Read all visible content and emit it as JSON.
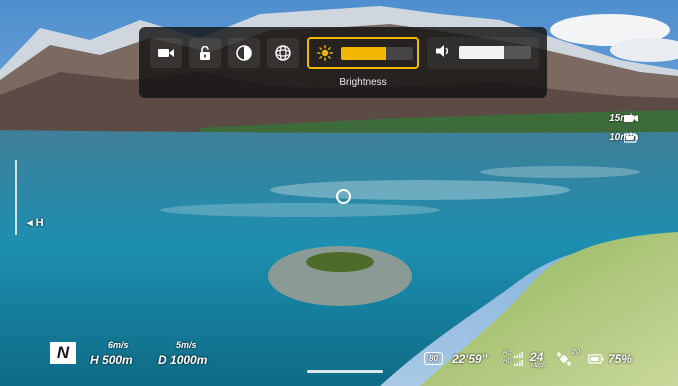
{
  "toolbar": {
    "tools": [
      {
        "name": "video-camera-icon"
      },
      {
        "name": "unlock-icon"
      },
      {
        "name": "contrast-icon"
      },
      {
        "name": "gimbal-sphere-icon"
      }
    ],
    "brightness": {
      "label": "Brightness",
      "level": 0.62,
      "icon": "sun-icon",
      "accent": "#f2b705"
    },
    "volume": {
      "level": 0.62,
      "icon": "speaker-icon"
    }
  },
  "timers": [
    {
      "value": "15min",
      "icon": "video-flight-icon"
    },
    {
      "value": "10min",
      "icon": "battery-flight-icon"
    }
  ],
  "altitude_scale": {
    "label": "H"
  },
  "telemetry": {
    "compass": "N",
    "v_speed": "6m/s",
    "h_speed": "5m/s",
    "height_label": "H",
    "height_value": "500m",
    "distance_label": "D",
    "distance_value": "1000m",
    "battery_box": "80",
    "flight_time": "22'59''",
    "signal_top": "RC",
    "signal_bottom": "HD",
    "bitrate": "24",
    "bitrate_unit": "Mbps",
    "satellites": "20",
    "battery_percent": "75%"
  }
}
